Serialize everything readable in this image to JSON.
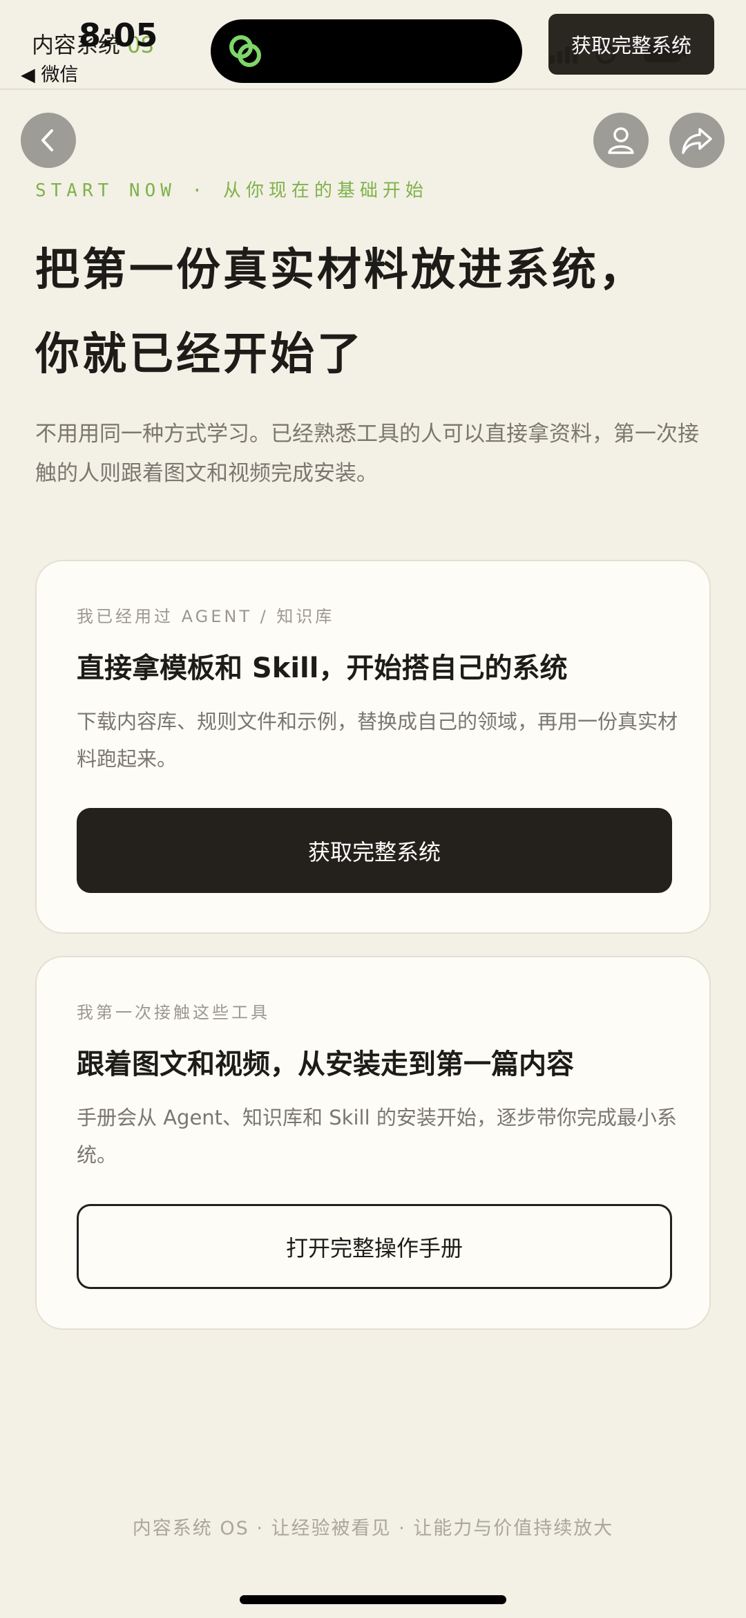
{
  "status_bar": {
    "time": "8:05",
    "back_app": "◀ 微信"
  },
  "topbar": {
    "brand_name": "内容系统",
    "brand_suffix": "OS",
    "cta_label": "获取完整系统"
  },
  "hero": {
    "kicker": "START NOW · 从你现在的基础开始",
    "headline_line1": "把第一份真实材料放进系统，",
    "headline_line2": "你就已经开始了",
    "intro": "不用用同一种方式学习。已经熟悉工具的人可以直接拿资料，第一次接触的人则跟着图文和视频完成安装。"
  },
  "cards": [
    {
      "tag": "我已经用过 AGENT / 知识库",
      "title": "直接拿模板和 Skill，开始搭自己的系统",
      "desc": "下载内容库、规则文件和示例，替换成自己的领域，再用一份真实材料跑起来。",
      "button": "获取完整系统"
    },
    {
      "tag": "我第一次接触这些工具",
      "title": "跟着图文和视频，从安装走到第一篇内容",
      "desc": "手册会从 Agent、知识库和 Skill 的安装开始，逐步带你完成最小系统。",
      "button": "打开完整操作手册"
    }
  ],
  "footer": {
    "text": "内容系统 OS · 让经验被看见 · 让能力与价值持续放大"
  },
  "colors": {
    "background": "#f3f0e6",
    "accent_green": "#7fb24a",
    "button_dark": "#24211c",
    "card_bg": "#fdfcf7"
  },
  "icons": [
    "wechat-mini-icon",
    "back-arrow-icon",
    "profile-icon",
    "share-icon",
    "signal-icon",
    "wifi-icon",
    "battery-icon"
  ]
}
